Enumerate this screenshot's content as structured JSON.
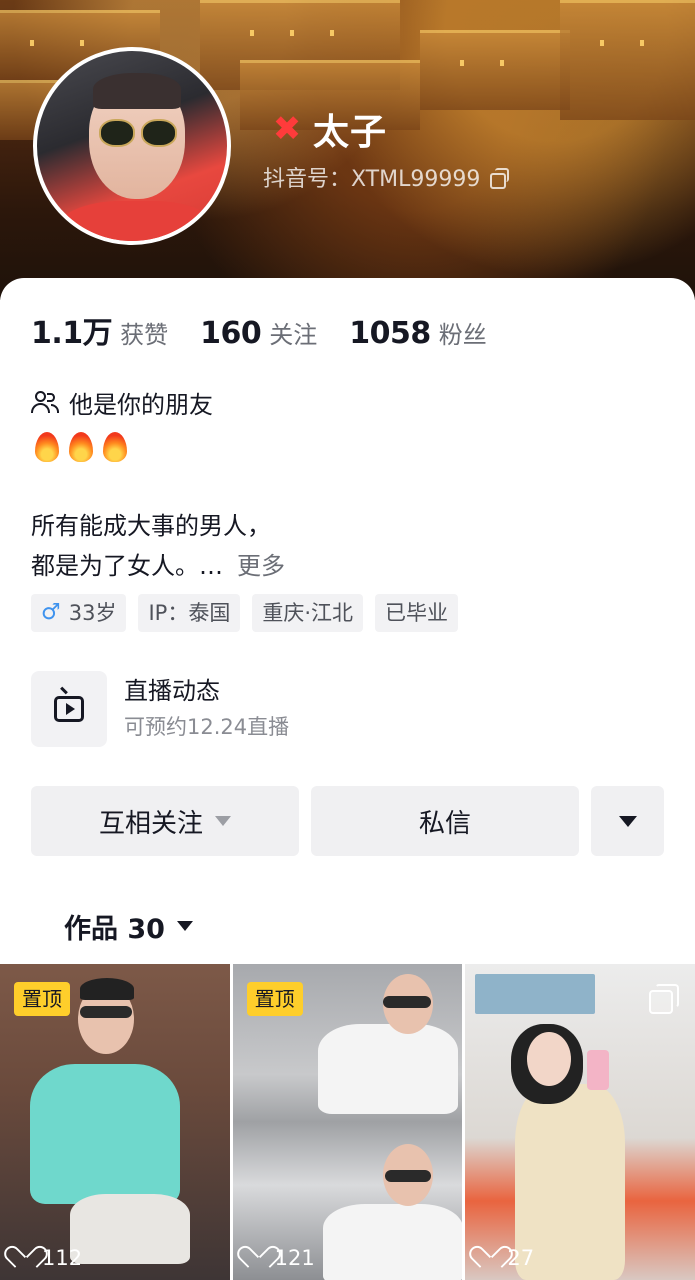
{
  "profile": {
    "name": "太子",
    "name_icon": "angry-symbol-icon",
    "douyin_id": "抖音号：XTML99999"
  },
  "stats": [
    {
      "num": "1.1万",
      "label": "获赞"
    },
    {
      "num": "160",
      "label": "关注"
    },
    {
      "num": "1058",
      "label": "粉丝"
    }
  ],
  "friend_text": "他是你的朋友",
  "bio": {
    "line1": "所有能成大事的男人，",
    "line2": "都是为了女人。…",
    "more": "更多"
  },
  "tags": {
    "gender_symbol": "♂",
    "age": "33岁",
    "ip": "IP：泰国",
    "location": "重庆·江北",
    "school": "已毕业"
  },
  "live": {
    "title": "直播动态",
    "subtitle": "可预约12.24直播"
  },
  "actions": {
    "follow_label": "互相关注",
    "message_label": "私信"
  },
  "works_tab": {
    "label": "作品 30"
  },
  "videos": [
    {
      "pinned_label": "置顶",
      "likes": "112"
    },
    {
      "pinned_label": "置顶",
      "likes": "121"
    },
    {
      "likes": "27",
      "multi_image": true
    }
  ],
  "colors": {
    "pin_badge": "#fece2b",
    "gender_male": "#3f93ee",
    "name_icon": "#ff3b3b"
  }
}
